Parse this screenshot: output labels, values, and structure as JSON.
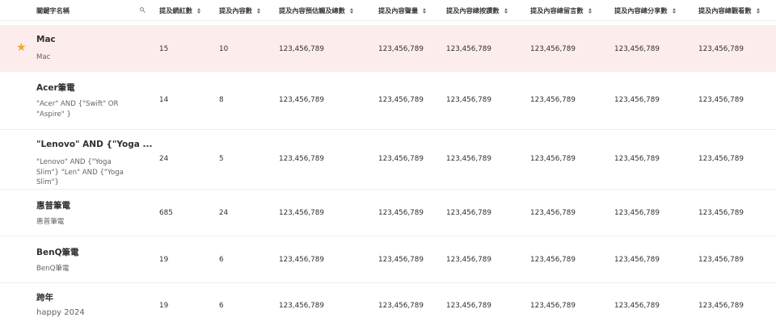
{
  "table": {
    "headers": [
      "關鍵字名稱",
      "提及網紅數",
      "提及內容數",
      "提及內容預估觸及總數",
      "提及內容聲量",
      "提及內容總按讚數",
      "提及內容總留言數",
      "提及內容總分享數",
      "提及內容總觀看數"
    ],
    "rows": [
      {
        "title": "Mac",
        "subtitle": "Mac",
        "starred": true,
        "metrics": [
          "15",
          "10",
          "123,456,789",
          "123,456,789",
          "123,456,789",
          "123,456,789",
          "123,456,789",
          "123,456,789"
        ]
      },
      {
        "title": "Acer筆電",
        "subtitle": "\"Acer\" AND {\"Swift\" OR \"Aspire\"  }",
        "starred": false,
        "metrics": [
          "14",
          "8",
          "123,456,789",
          "123,456,789",
          "123,456,789",
          "123,456,789",
          "123,456,789",
          "123,456,789"
        ]
      },
      {
        "title": "\"Lenovo\" AND {\"Yoga ...",
        "subtitle": "\"Lenovo\" AND {\"Yoga Slim\"} \"Len\"  AND {\"Yoga Slim\"}",
        "starred": false,
        "metrics": [
          "24",
          "5",
          "123,456,789",
          "123,456,789",
          "123,456,789",
          "123,456,789",
          "123,456,789",
          "123,456,789"
        ]
      },
      {
        "title": "惠普筆電",
        "subtitle": "惠普筆電",
        "starred": false,
        "metrics": [
          "685",
          "24",
          "123,456,789",
          "123,456,789",
          "123,456,789",
          "123,456,789",
          "123,456,789",
          "123,456,789"
        ]
      },
      {
        "title": "BenQ筆電",
        "subtitle": "BenQ筆電",
        "starred": false,
        "metrics": [
          "19",
          "6",
          "123,456,789",
          "123,456,789",
          "123,456,789",
          "123,456,789",
          "123,456,789",
          "123,456,789"
        ]
      },
      {
        "title": "跨年",
        "subtitle": "happy 2024",
        "starred": false,
        "metrics": [
          "19",
          "6",
          "123,456,789",
          "123,456,789",
          "123,456,789",
          "123,456,789",
          "123,456,789",
          "123,456,789"
        ]
      }
    ]
  },
  "colors": {
    "highlight_row": "#fdecec",
    "star": "#f5a623",
    "divider": "#eceff3"
  },
  "icons": {
    "search": "search-icon",
    "sort": "sort-icon",
    "star": "star-icon"
  }
}
